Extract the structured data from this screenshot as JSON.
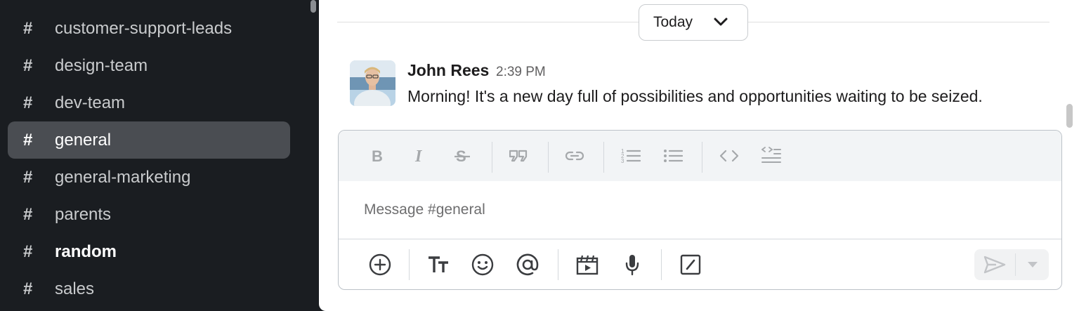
{
  "sidebar": {
    "channels": [
      {
        "hash": "#",
        "name": "customer-support-leads"
      },
      {
        "hash": "#",
        "name": "design-team"
      },
      {
        "hash": "#",
        "name": "dev-team"
      },
      {
        "hash": "#",
        "name": "general"
      },
      {
        "hash": "#",
        "name": "general-marketing"
      },
      {
        "hash": "#",
        "name": "parents"
      },
      {
        "hash": "#",
        "name": "random"
      },
      {
        "hash": "#",
        "name": "sales"
      }
    ],
    "active_channel": "general",
    "unread_channels": [
      "random"
    ]
  },
  "main": {
    "date_divider": "Today",
    "message": {
      "author": "John Rees",
      "time": "2:39 PM",
      "text": "Morning! It's a new day full of possibilities and opportunities waiting to be seized."
    },
    "composer": {
      "placeholder": "Message #general",
      "format_tools": [
        "bold-icon",
        "italic-icon",
        "strikethrough-icon",
        "quote-icon",
        "link-icon",
        "ordered-list-icon",
        "bulleted-list-icon",
        "code-icon",
        "code-block-icon"
      ],
      "bottom_tools": [
        "plus-circle-icon",
        "text-format-icon",
        "emoji-icon",
        "mention-icon",
        "video-clip-icon",
        "microphone-icon",
        "slash-command-icon"
      ],
      "send_icon": "send-icon",
      "send_options_icon": "caret-down-icon"
    }
  },
  "colors": {
    "sidebar_bg": "#1a1d21",
    "active_channel_bg": "#4a4d52",
    "main_bg": "#ffffff",
    "composer_toolbar_bg": "#f2f4f6"
  }
}
